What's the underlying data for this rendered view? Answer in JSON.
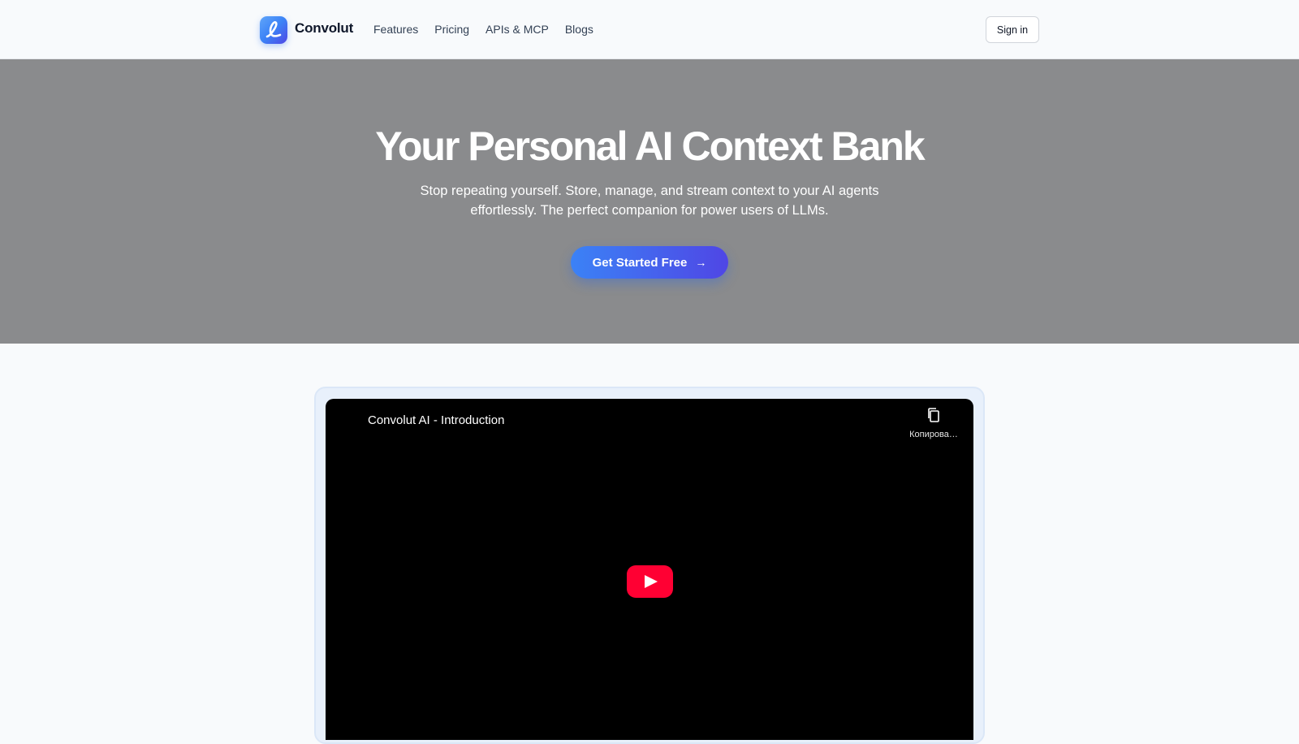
{
  "header": {
    "brand": "Convolut",
    "nav": [
      "Features",
      "Pricing",
      "APIs & MCP",
      "Blogs"
    ],
    "signin_label": "Sign in"
  },
  "hero": {
    "title": "Your Personal AI Context Bank",
    "subtitle": "Stop repeating yourself. Store, manage, and stream context to your AI agents effortlessly. The perfect companion for power users of LLMs.",
    "cta_label": "Get Started Free",
    "cta_icon": "arrow-right-icon"
  },
  "video": {
    "title": "Convolut AI - Introduction",
    "copy_label": "Копирова…",
    "copy_icon": "copy-icon",
    "play_icon": "youtube-play-icon"
  },
  "colors": {
    "accent_start": "#3b82f6",
    "accent_end": "#4f46e5",
    "hero_bg": "#8a8b8d",
    "youtube_red": "#ff0033"
  }
}
